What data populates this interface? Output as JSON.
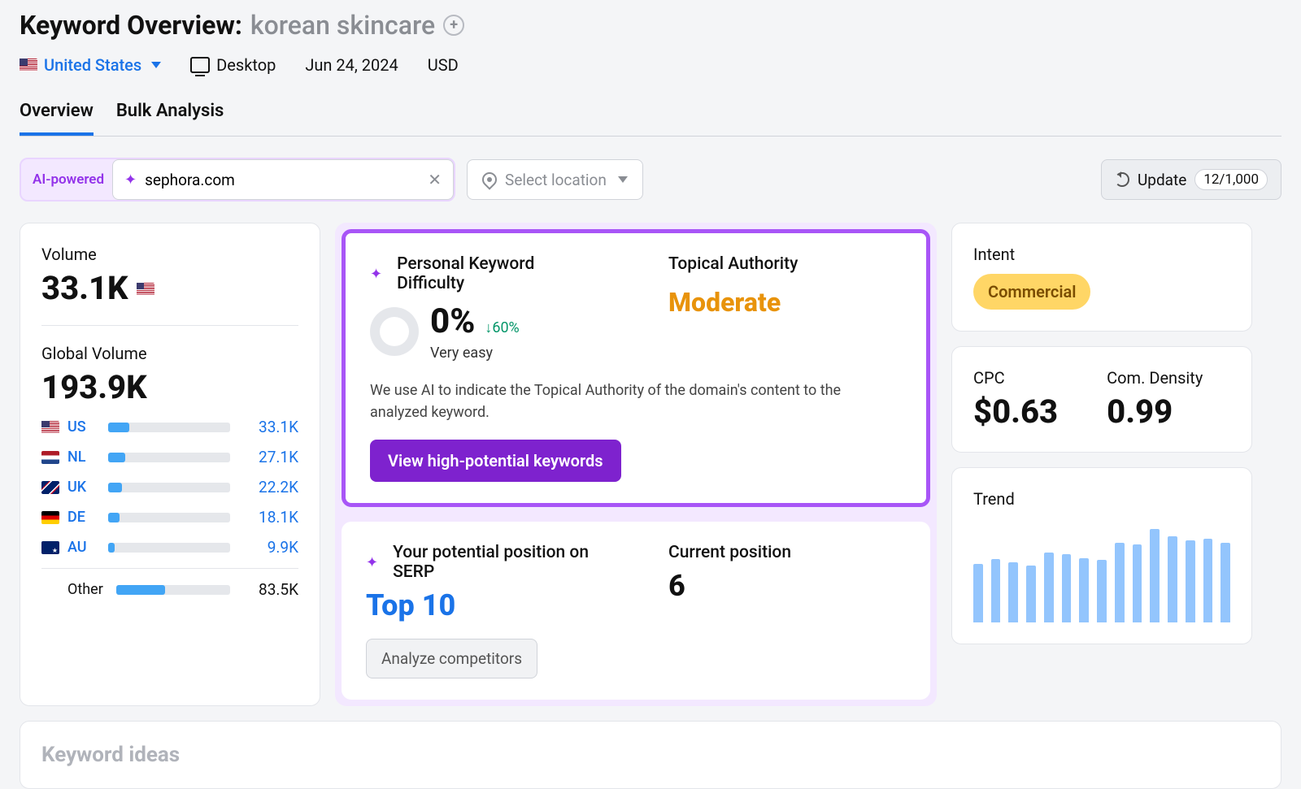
{
  "header": {
    "title_prefix": "Keyword Overview:",
    "keyword": "korean skincare",
    "country": "United States",
    "device": "Desktop",
    "date": "Jun 24, 2024",
    "currency": "USD"
  },
  "tabs": {
    "overview": "Overview",
    "bulk": "Bulk Analysis"
  },
  "filters": {
    "ai_label": "AI-powered",
    "domain_value": "sephora.com",
    "location_placeholder": "Select location",
    "update_label": "Update",
    "quota": "12/1,000"
  },
  "volume": {
    "label": "Volume",
    "value": "33.1K",
    "global_label": "Global Volume",
    "global_value": "193.9K",
    "countries": [
      {
        "code": "US",
        "value": "33.1K",
        "pct": 17,
        "flag": "flag-us",
        "link_style": true
      },
      {
        "code": "NL",
        "value": "27.1K",
        "pct": 14,
        "flag": "flag-nl",
        "link_style": true
      },
      {
        "code": "UK",
        "value": "22.2K",
        "pct": 11,
        "flag": "flag-uk",
        "link_style": true
      },
      {
        "code": "DE",
        "value": "18.1K",
        "pct": 9,
        "flag": "flag-de",
        "link_style": true
      },
      {
        "code": "AU",
        "value": "9.9K",
        "pct": 5,
        "flag": "flag-au",
        "link_style": true
      }
    ],
    "other_label": "Other",
    "other_value": "83.5K",
    "other_pct": 43
  },
  "pkw": {
    "title": "Personal Keyword Difficulty",
    "value": "0%",
    "delta": "↓60%",
    "subtitle": "Very easy",
    "ta_title": "Topical Authority",
    "ta_value": "Moderate",
    "desc": "We use AI to indicate the Topical Authority of the domain's content to the analyzed keyword.",
    "button": "View high-potential keywords"
  },
  "serp": {
    "pp_title": "Your potential position on SERP",
    "pp_value": "Top 10",
    "cp_title": "Current position",
    "cp_value": "6",
    "button": "Analyze competitors"
  },
  "intent": {
    "label": "Intent",
    "value": "Commercial"
  },
  "metrics": {
    "cpc_label": "CPC",
    "cpc_value": "$0.63",
    "cd_label": "Com. Density",
    "cd_value": "0.99"
  },
  "trend": {
    "label": "Trend",
    "bars": [
      60,
      65,
      62,
      58,
      72,
      70,
      66,
      64,
      82,
      80,
      96,
      88,
      84,
      86,
      82
    ]
  },
  "ideas": {
    "title": "Keyword ideas"
  },
  "chart_data": {
    "type": "bar",
    "title": "Trend",
    "categories": [
      "1",
      "2",
      "3",
      "4",
      "5",
      "6",
      "7",
      "8",
      "9",
      "10",
      "11",
      "12",
      "13",
      "14",
      "15"
    ],
    "values": [
      60,
      65,
      62,
      58,
      72,
      70,
      66,
      64,
      82,
      80,
      96,
      88,
      84,
      86,
      82
    ],
    "xlabel": "",
    "ylabel": "",
    "ylim": [
      0,
      100
    ]
  }
}
